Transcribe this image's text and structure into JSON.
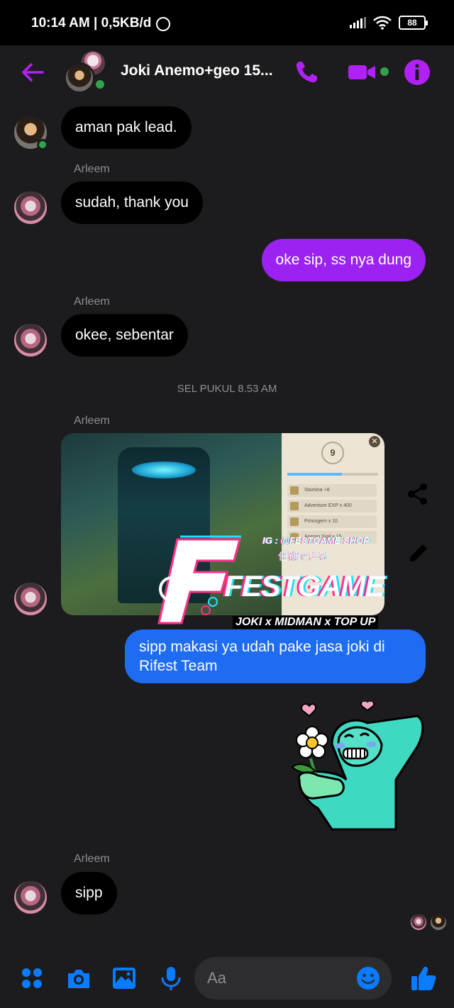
{
  "status_bar": {
    "time_speed": "10:14 AM | 0,5KB/d",
    "battery": "88"
  },
  "header": {
    "title": "Joki Anemo+geo 15..."
  },
  "messages": [
    {
      "text": "aman pak lead."
    },
    {
      "sender": "Arleem",
      "text": "sudah, thank you"
    },
    {
      "text": "oke sip, ss nya dung"
    },
    {
      "sender": "Arleem",
      "text": "okee, sebentar"
    },
    {
      "timestamp": "SEL PUKUL 8.53 AM"
    },
    {
      "sender": "Arleem"
    },
    {
      "text": "sipp makasi ya udah pake jasa joki di Rifest Team"
    },
    {
      "sender": "Arleem",
      "text": "sipp"
    }
  ],
  "image_panel": {
    "level": "9",
    "rows": [
      "Stamina +8",
      "Adventure EXP x 400",
      "Primogem x 10",
      "Anemo Sigil x 15"
    ]
  },
  "watermark": {
    "ig": "IG : @FESTGAME SHOP",
    "jp": "任務できる",
    "word": "FESTGAME",
    "sub": "JOKI x MIDMAN x TOP UP"
  },
  "composer": {
    "placeholder": "Aa"
  },
  "colors": {
    "accent_purple": "#9b22f0",
    "sent_blue": "#1e6cf2",
    "online_green": "#31a24c",
    "bubble_received": "#000000",
    "background": "#1c1c1e"
  },
  "icons": {
    "header": [
      "back-arrow-icon",
      "phone-icon",
      "video-camera-icon",
      "info-icon"
    ],
    "bottom": [
      "apps-grid-icon",
      "camera-icon",
      "gallery-icon",
      "microphone-icon",
      "emoji-icon",
      "thumbs-up-icon"
    ],
    "side": [
      "share-icon",
      "edit-icon"
    ]
  }
}
